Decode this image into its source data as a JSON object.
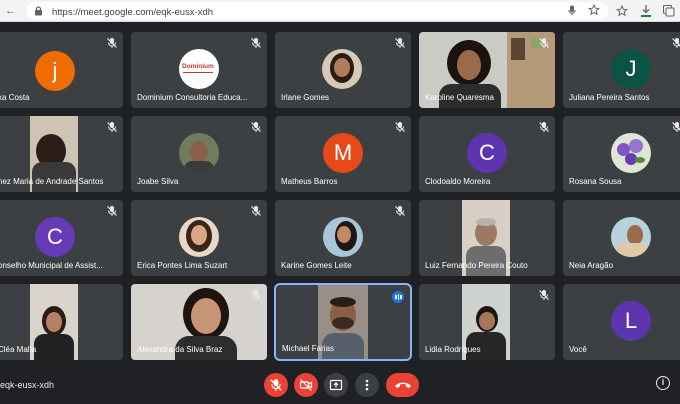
{
  "browser": {
    "url": "https://meet.google.com/eqk-eusx-xdh"
  },
  "tiles": [
    {
      "name": "ka Costa",
      "initial": "j",
      "avatar_color": "#ef6c00"
    },
    {
      "name": "Dominium Consultoria Educa...",
      "logo_text": "Dominium"
    },
    {
      "name": "Irlane Gomes"
    },
    {
      "name": "Karoline Quaresma"
    },
    {
      "name": "Juliana Pereira Santos",
      "initial": "J",
      "avatar_color": "#0b5345"
    },
    {
      "name": "nez Maria de Andrade Santos"
    },
    {
      "name": "Joabe Silva"
    },
    {
      "name": "Matheus Barros",
      "initial": "M",
      "avatar_color": "#e64a19"
    },
    {
      "name": "Clodoaldo Moreira",
      "initial": "C",
      "avatar_color": "#5e35b1"
    },
    {
      "name": "Rosana Sousa"
    },
    {
      "name": "onselho Municipal de Assist...",
      "initial": "C",
      "avatar_color": "#673ab7"
    },
    {
      "name": "Erica Pontes Lima Suzart"
    },
    {
      "name": "Karine Gomes Leite"
    },
    {
      "name": "Luiz Fernando Pereira Couto"
    },
    {
      "name": "Neia Aragão"
    },
    {
      "name": "Cléa Malta"
    },
    {
      "name": "Alexandra da Silva Braz"
    },
    {
      "name": "Michael Farias"
    },
    {
      "name": "Lidia Rodrigues"
    },
    {
      "name": "Você",
      "initial": "L",
      "avatar_color": "#5e35b1"
    }
  ],
  "meeting": {
    "code": "eqk-eusx-xdh"
  },
  "colors": {
    "background": "#202124",
    "tile": "#3c4043",
    "danger": "#ea4335",
    "active": "#8ab4f8"
  }
}
